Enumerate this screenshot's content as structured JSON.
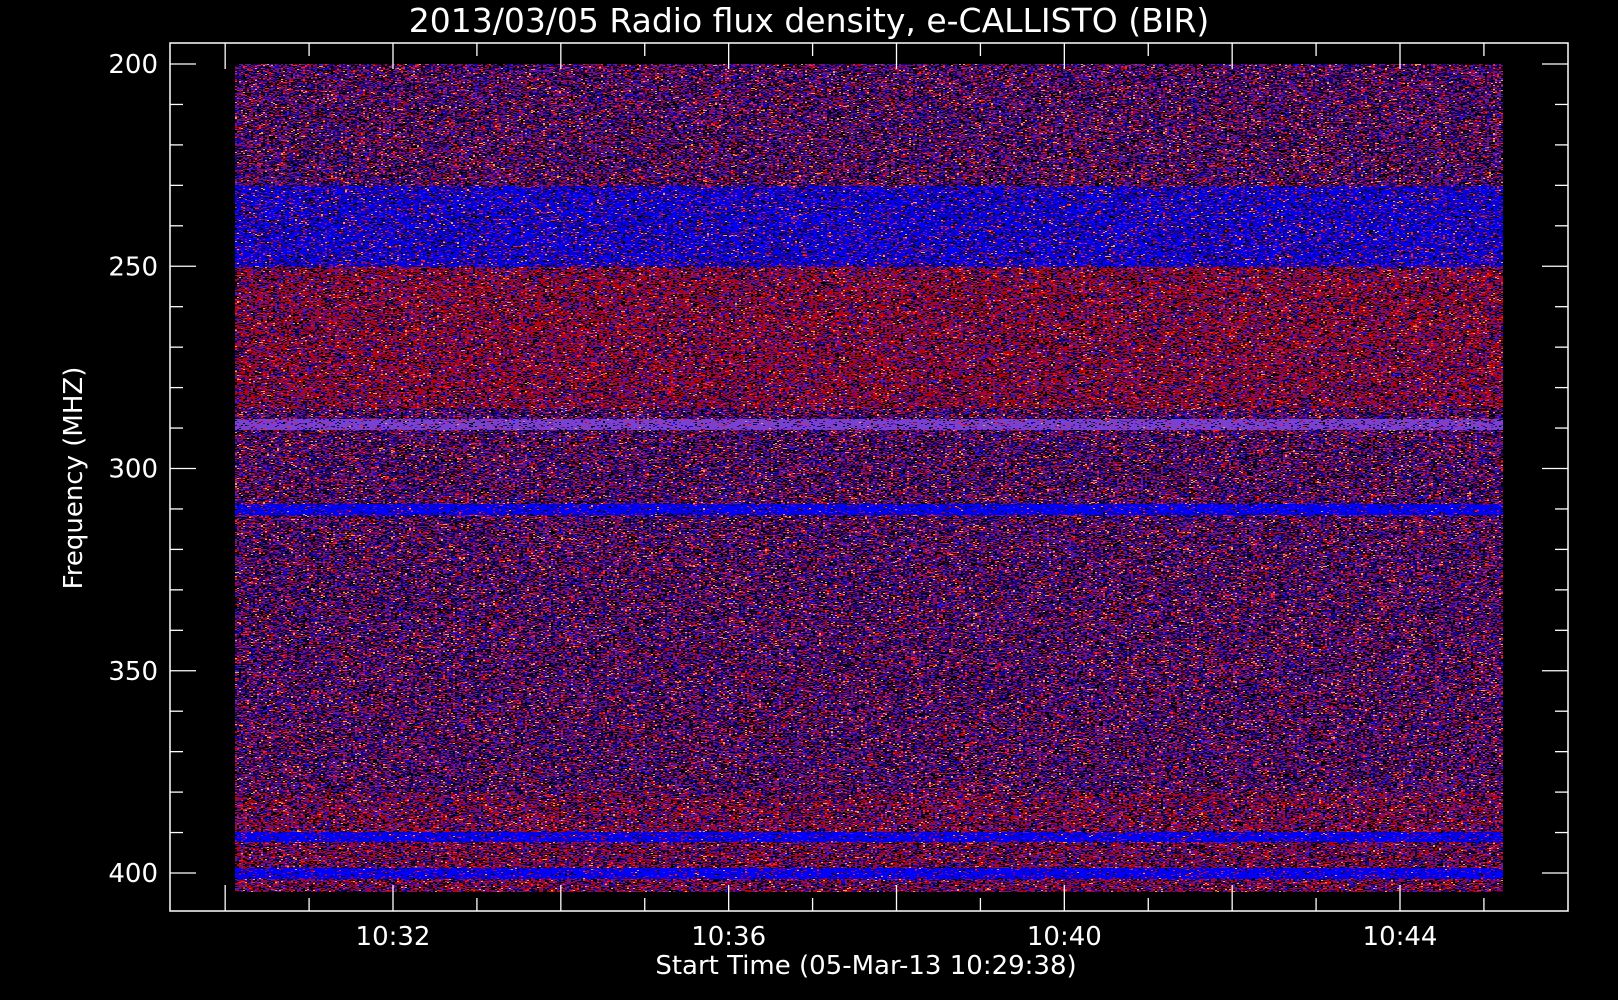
{
  "chart_data": {
    "type": "heatmap",
    "title": "2013/03/05  Radio flux density, e-CALLISTO (BIR)",
    "xlabel": "Start Time (05-Mar-13 10:29:38)",
    "ylabel": "Frequency (MHZ)",
    "x_start": "10:29:38",
    "x_end": "10:44:45",
    "xlim_minutes": [
      29.633,
      44.75
    ],
    "ylim": [
      404,
      200
    ],
    "x_tick_labels": [
      "10:32",
      "10:36",
      "10:40",
      "10:44"
    ],
    "x_tick_values_minutes": [
      32,
      36,
      40,
      44
    ],
    "y_tick_labels": [
      "200",
      "250",
      "300",
      "350",
      "400"
    ],
    "y_tick_values": [
      200,
      250,
      300,
      350,
      400
    ],
    "y_axis_inverted": true,
    "colormap": [
      "#000000",
      "#2a0060",
      "#5a1aa0",
      "#0000ff",
      "#c00000",
      "#ff2020",
      "#ffa040"
    ],
    "features": [
      {
        "kind": "enhanced_band",
        "freq_range": [
          230,
          250
        ],
        "color": "#0000ff"
      },
      {
        "kind": "enhanced_band",
        "freq_range": [
          250,
          285
        ],
        "color": "#c00000"
      },
      {
        "kind": "narrow_line",
        "freq": 289,
        "color": "#7a40d0"
      },
      {
        "kind": "narrow_line",
        "freq": 310,
        "color": "#0000ff"
      },
      {
        "kind": "narrow_line",
        "freq": 391,
        "color": "#0000ff"
      },
      {
        "kind": "narrow_line",
        "freq": 400,
        "color": "#0000ff"
      }
    ]
  }
}
